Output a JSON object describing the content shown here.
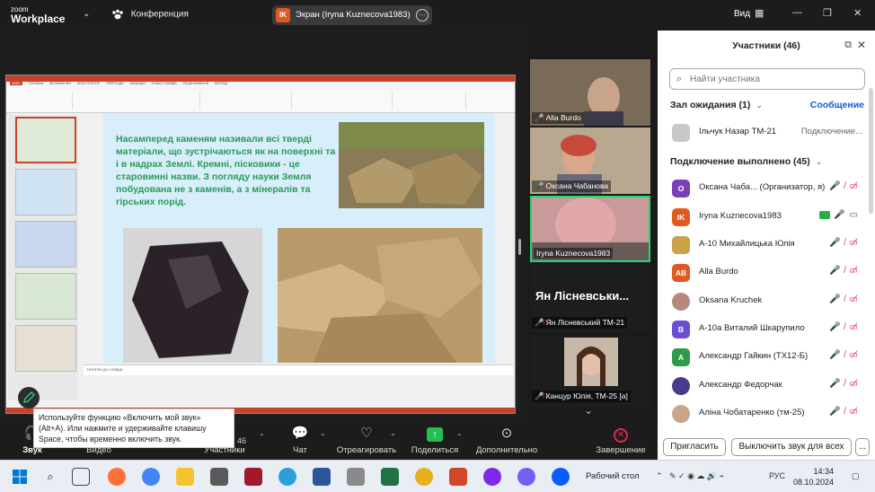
{
  "app": {
    "logo_line1": "zoom",
    "logo_line2": "Workplace",
    "conference_label": "Конференция",
    "share_avatar": "IK",
    "share_label": "Экран (Iryna Kuznecova1983)",
    "view_label": "Вид"
  },
  "slide": {
    "text": "Насамперед каменям називали всі тверді матеріали, що зустрічаються як на поверхні та і в надрах Землі. Кремні, пісковики - це старовинні назви. З погляду науки Земля побудована не з каменів, а з мінералів та гірських порід.",
    "notes": "Нотатки до слайда"
  },
  "videos": [
    {
      "name": "Alla Burdo"
    },
    {
      "name": "Оксана Чабанова"
    },
    {
      "name": "Iryna Kuznecova1983"
    }
  ],
  "name_card": {
    "title": "Ян Лісневськи...",
    "label": "Ян Лісневський ТМ-21"
  },
  "small_video": {
    "label": "Канцур Юлія, ТМ-25 [а]"
  },
  "panel": {
    "title": "Участники (46)",
    "search_placeholder": "Найти участника",
    "waiting_header": "Зал ожидания (1)",
    "message_link": "Сообщение",
    "waiting": [
      {
        "name": "Ільчук Назар ТМ-21",
        "status": "Подключение..."
      }
    ],
    "connected_header": "Подключение выполнено (45)",
    "participants": [
      {
        "initials": "O",
        "name": "Оксана Чаба... (Организатор, я)",
        "color": "#7b3fb8"
      },
      {
        "initials": "IK",
        "name": "Iryna Kuznecova1983",
        "color": "#e05a1f"
      },
      {
        "initials": "",
        "name": "А-10 Михайлицька Юлія",
        "color": "#c9a24a"
      },
      {
        "initials": "AB",
        "name": "Alla Burdo",
        "color": "#e05a1f"
      },
      {
        "initials": "",
        "name": "Oksana Kruchek",
        "color": "#b58a7a"
      },
      {
        "initials": "B",
        "name": "А-10а Виталий Шкарупило",
        "color": "#6b4fd3"
      },
      {
        "initials": "A",
        "name": "Александр Гайкин (ТХ12-Б)",
        "color": "#2e9a4a"
      },
      {
        "initials": "",
        "name": "Александр Федорчак",
        "color": "#4a3a8a"
      },
      {
        "initials": "",
        "name": "Аліна Чобатаренко (тм-25)",
        "color": "#c9a58a"
      }
    ],
    "invite_label": "Пригласить",
    "mute_all_label": "Выключить звук для всех",
    "more_label": "..."
  },
  "toolbar": {
    "sound": "Звук",
    "video": "Видео",
    "participants": "Участники",
    "participants_count": "46",
    "chat": "Чат",
    "react": "Отреагировать",
    "share": "Поделиться",
    "more": "Дополнительно",
    "end": "Завершение",
    "tooltip": "Используйте функцию «Включить мой звук» (Alt+A). Или нажмите и удерживайте клавишу Space, чтобы временно включить звук."
  },
  "taskbar": {
    "desktop_label": "Рабочий стол",
    "lang": "РУС",
    "time": "14:34",
    "date": "08.10.2024"
  },
  "colors": {
    "accent": "#0e5bd3",
    "danger": "#e0284a",
    "active_speaker": "#23d96a",
    "ppt_red": "#c4432a"
  }
}
